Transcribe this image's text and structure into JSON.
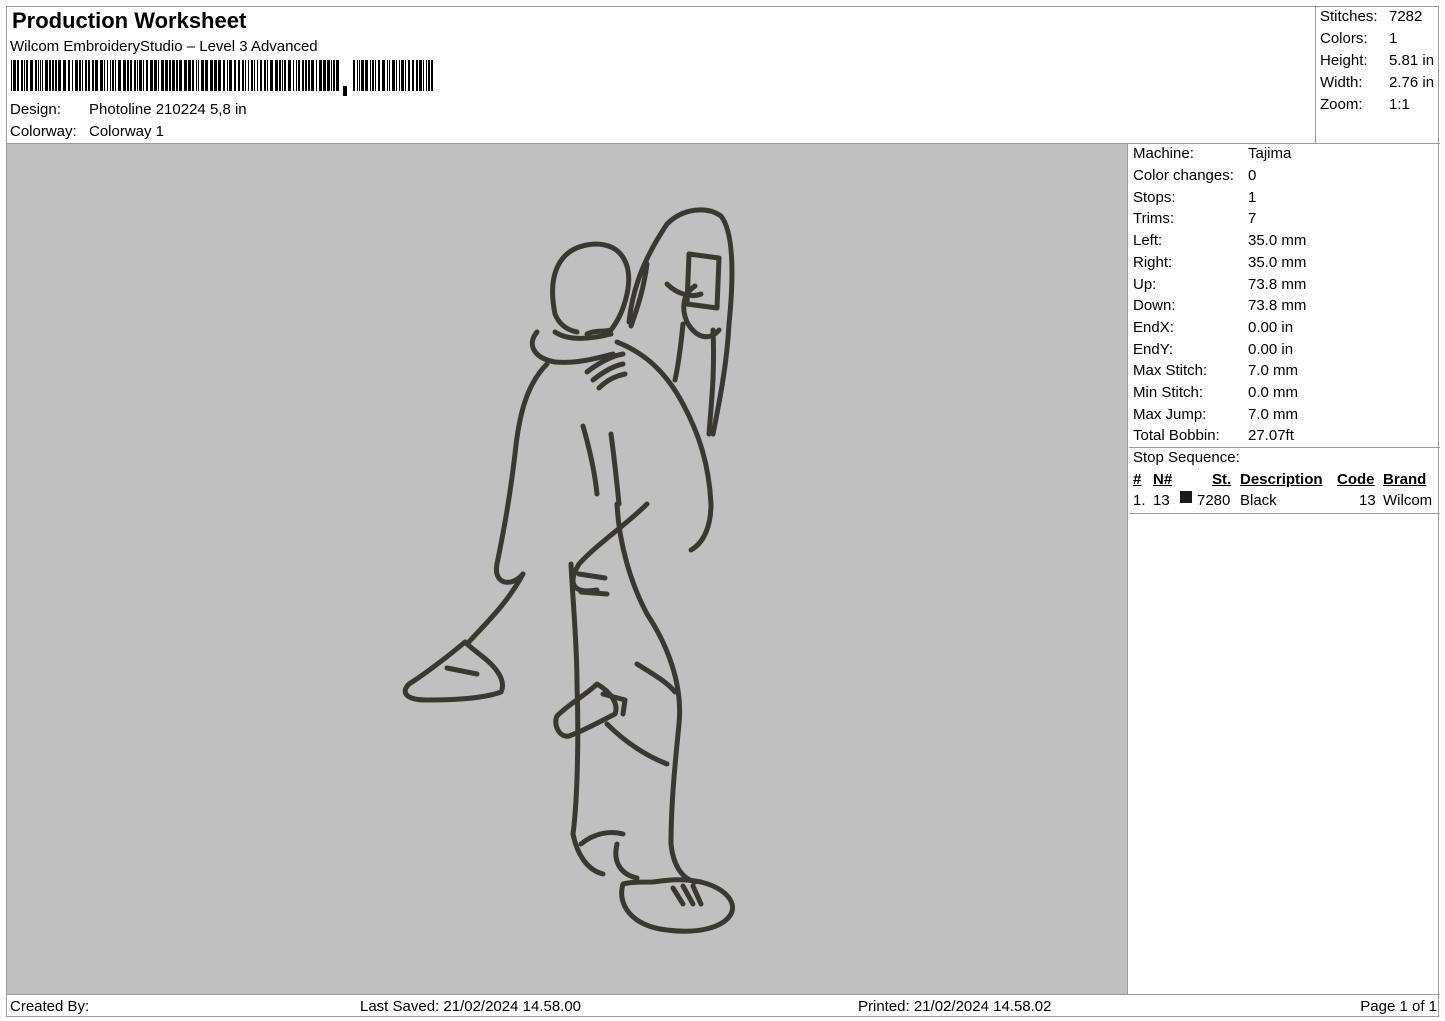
{
  "header": {
    "title": "Production Worksheet",
    "subtitle": "Wilcom EmbroideryStudio – Level 3 Advanced",
    "design_label": "Design:",
    "design_value": "Photoline 210224 5,8 in",
    "colorway_label": "Colorway:",
    "colorway_value": "Colorway 1"
  },
  "stats": [
    {
      "label": "Stitches:",
      "value": "7282"
    },
    {
      "label": "Colors:",
      "value": "1"
    },
    {
      "label": "Height:",
      "value": "5.81 in"
    },
    {
      "label": "Width:",
      "value": "2.76 in"
    },
    {
      "label": "Zoom:",
      "value": "1:1"
    }
  ],
  "machine_info": [
    {
      "label": "Machine:",
      "value": "Tajima"
    },
    {
      "label": "Color changes:",
      "value": "0"
    },
    {
      "label": "Stops:",
      "value": "1"
    },
    {
      "label": "Trims:",
      "value": "7"
    },
    {
      "label": "Left:",
      "value": "35.0 mm"
    },
    {
      "label": "Right:",
      "value": "35.0 mm"
    },
    {
      "label": "Up:",
      "value": "73.8 mm"
    },
    {
      "label": "Down:",
      "value": "73.8 mm"
    },
    {
      "label": "EndX:",
      "value": "0.00 in"
    },
    {
      "label": "EndY:",
      "value": "0.00 in"
    },
    {
      "label": "Max Stitch:",
      "value": "7.0 mm"
    },
    {
      "label": "Min Stitch:",
      "value": "0.0 mm"
    },
    {
      "label": "Max Jump:",
      "value": "7.0 mm"
    },
    {
      "label": "Total Bobbin:",
      "value": "27.07ft"
    }
  ],
  "stop_sequence": {
    "title": "Stop Sequence:",
    "columns": [
      "#",
      "N#",
      "St.",
      "Description",
      "Code",
      "Brand"
    ],
    "rows": [
      {
        "index": "1.",
        "needle": "13",
        "swatch_color": "#1a1a1a",
        "stitches": "7280",
        "description": "Black",
        "code": "13",
        "brand": "Wilcom"
      }
    ]
  },
  "footer": {
    "created_by": "Created By:",
    "last_saved": "Last Saved: 21/02/2024 14.58.00",
    "printed": "Printed: 21/02/2024 14.58.02",
    "page": "Page 1 of 1"
  },
  "colors": {
    "canvas_bg": "#c0c0c0",
    "thread": "#3a3832"
  }
}
